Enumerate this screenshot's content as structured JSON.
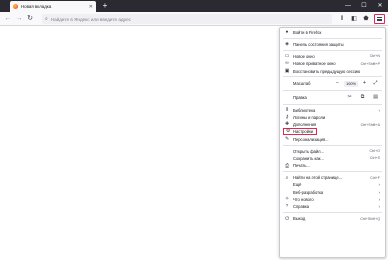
{
  "tabs": [
    {
      "title": "Новая вкладка"
    }
  ],
  "urlbar": {
    "placeholder": "Найдите в Яндекс или введите адрес"
  },
  "menu": {
    "signin": "Войти в Firefox",
    "protection": "Панель состояния защиты",
    "new_window": {
      "label": "Новое окно",
      "shortcut": "Ctrl+N"
    },
    "private_window": {
      "label": "Новое приватное окно",
      "shortcut": "Ctrl+Shift+P"
    },
    "restore_session": "Восстановить предыдущую сессию",
    "zoom": {
      "label": "Масштаб",
      "value": "100%"
    },
    "edit": {
      "label": "Правка"
    },
    "library": "Библиотека",
    "logins": "Логины и пароли",
    "addons": {
      "label": "Дополнения",
      "shortcut": "Ctrl+Shift+A"
    },
    "settings": "Настройки",
    "customize": "Персонализация...",
    "open_file": {
      "label": "Открыть файл...",
      "shortcut": "Ctrl+O"
    },
    "save_as": {
      "label": "Сохранить как...",
      "shortcut": "Ctrl+S"
    },
    "print": "Печать...",
    "find": {
      "label": "Найти на этой странице...",
      "shortcut": "Ctrl+F"
    },
    "more": "Ещё",
    "web_dev": "Веб-разработка",
    "whats_new": "Что нового",
    "help": "Справка",
    "exit": {
      "label": "Выход",
      "shortcut": "Ctrl+Shift+Q"
    }
  },
  "colors": {
    "highlight": "#e22850",
    "tabstrip": "#2b2a33"
  }
}
